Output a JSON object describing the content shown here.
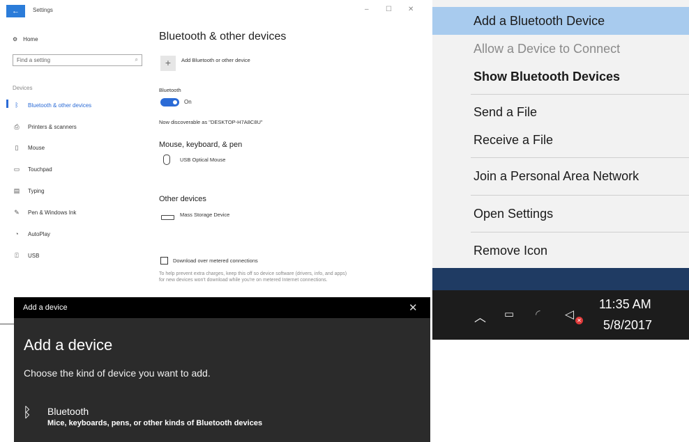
{
  "settings_window": {
    "title": "Settings",
    "back_icon": "←",
    "controls": {
      "minimize": "–",
      "maximize": "☐",
      "close": "✕"
    },
    "nav": {
      "home": "Home",
      "search_placeholder": "Find a setting",
      "section": "Devices",
      "items": [
        {
          "label": "Bluetooth & other devices",
          "icon": "bluetooth-icon",
          "active": true
        },
        {
          "label": "Printers & scanners",
          "icon": "printer-icon"
        },
        {
          "label": "Mouse",
          "icon": "mouse-icon"
        },
        {
          "label": "Touchpad",
          "icon": "touchpad-icon"
        },
        {
          "label": "Typing",
          "icon": "keyboard-icon"
        },
        {
          "label": "Pen & Windows Ink",
          "icon": "pen-icon"
        },
        {
          "label": "AutoPlay",
          "icon": "autoplay-icon"
        },
        {
          "label": "USB",
          "icon": "usb-icon"
        }
      ]
    },
    "content": {
      "title": "Bluetooth & other devices",
      "add_device": "Add Bluetooth or other device",
      "bluetooth_label": "Bluetooth",
      "toggle_state": "On",
      "discoverable": "Now discoverable as \"DESKTOP-H7A8C8U\"",
      "mouse_section": "Mouse, keyboard, & pen",
      "mouse_device": "USB Optical Mouse",
      "other_section": "Other devices",
      "other_device": "Mass Storage Device",
      "metered_checkbox": "Download over metered connections",
      "help_text": "To help prevent extra charges, keep this off so device software (drivers, info, and apps) for new devices won't download while you're on metered Internet connections."
    }
  },
  "tray_menu": {
    "items": [
      {
        "label": "Add a Bluetooth Device",
        "state": "highlighted"
      },
      {
        "label": "Allow a Device to Connect",
        "state": "disabled"
      },
      {
        "label": "Show Bluetooth Devices",
        "state": "bold"
      },
      {
        "label": "Send a File"
      },
      {
        "label": "Receive a File"
      },
      {
        "label": "Join a Personal Area Network"
      },
      {
        "label": "Open Settings"
      },
      {
        "label": "Remove Icon"
      }
    ],
    "clock": {
      "time": "11:35 AM",
      "date": "5/8/2017"
    },
    "icons": [
      "chevron-up-icon",
      "battery-icon",
      "wifi-icon",
      "volume-muted-icon"
    ]
  },
  "add_device_dialog": {
    "window_title": "Add a device",
    "heading": "Add a device",
    "subheading": "Choose the kind of device you want to add.",
    "option_title": "Bluetooth",
    "option_desc": "Mice, keyboards, pens, or other kinds of Bluetooth devices",
    "close_icon": "✕",
    "bt_icon": "∦"
  },
  "colors": {
    "accent": "#2b6bd6",
    "menu_highlight": "#a8cbee",
    "dialog_bg": "#2b2b2b",
    "taskbar_bg": "#1c1c1c"
  }
}
